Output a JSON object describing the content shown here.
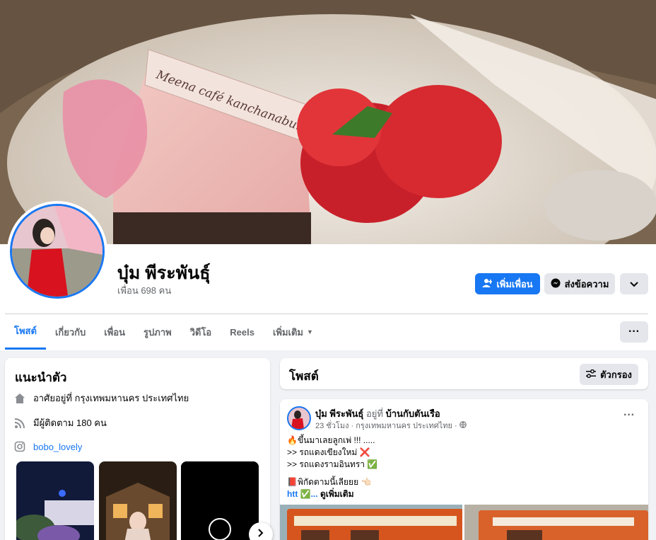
{
  "profile": {
    "name": "บุ๋ม พีระพันธุ์",
    "friends": "เพื่อน 698 คน",
    "cover_text": "Meena café kanchanaburi"
  },
  "actions": {
    "add_friend": "เพิ่มเพื่อน",
    "message": "ส่งข้อความ"
  },
  "tabs": [
    {
      "label": "โพสต์"
    },
    {
      "label": "เกี่ยวกับ"
    },
    {
      "label": "เพื่อน"
    },
    {
      "label": "รูปภาพ"
    },
    {
      "label": "วิดีโอ"
    },
    {
      "label": "Reels"
    },
    {
      "label": "เพิ่มเติม"
    }
  ],
  "intro": {
    "title": "แนะนำตัว",
    "lives_in": "อาศัยอยู่ที่ กรุงเทพมหานคร ประเทศไทย",
    "followers": "มีผู้ติดตาม 180 คน",
    "instagram": "bobo_lovely"
  },
  "posts_section": {
    "title": "โพสต์",
    "filter": "ตัวกรอง"
  },
  "post": {
    "author": "บุ๋ม พีระพันธุ์",
    "at": "อยู่ที่",
    "place": "บ้านกับตันเรือ",
    "meta": "23 ชั่วโมง · กรุงเทพมหานคร ประเทศไทย ·",
    "line1": "🔥ขึ้นมาเลยลูกเพ่ !!! .....",
    "line2": ">> รถแดงเขียงใหม่ ❌",
    "line3": ">> รถแดงรามอินทรา ✅",
    "line4": "📕พิกัดตามนี้เลียยย 👈🏻",
    "line5_prefix": "htt ✅...",
    "see_more": "ดูเพิ่มเติม"
  },
  "colors": {
    "accent": "#1877f2",
    "background": "#f0f2f5",
    "button_grey": "#e4e6eb"
  }
}
